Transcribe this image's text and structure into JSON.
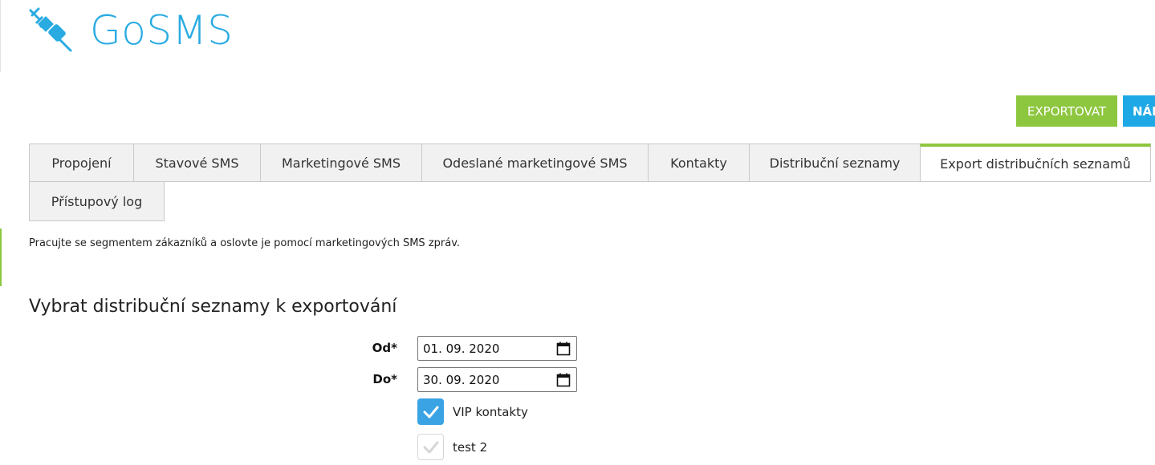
{
  "brand": {
    "name": "GoSMS",
    "color": "#29abe2"
  },
  "actions": {
    "export_label": "EXPORTOVAT",
    "help_label": "NÁP",
    "export_color": "#8dc63f",
    "help_color": "#1ea9e6"
  },
  "tabs": [
    {
      "label": "Propojení",
      "active": false
    },
    {
      "label": "Stavové SMS",
      "active": false
    },
    {
      "label": "Marketingové SMS",
      "active": false
    },
    {
      "label": "Odeslané marketingové SMS",
      "active": false
    },
    {
      "label": "Kontakty",
      "active": false
    },
    {
      "label": "Distribuční seznamy",
      "active": false
    },
    {
      "label": "Export distribučních seznamů",
      "active": true
    },
    {
      "label": "Přístupový log",
      "active": false
    }
  ],
  "intro_text": "Pracujte se segmentem zákazníků a oslovte je pomocí marketingových SMS zpráv.",
  "section_title": "Vybrat distribuční seznamy k exportování",
  "form": {
    "from_label": "Od*",
    "from_value": "01. 09. 2020",
    "to_label": "Do*",
    "to_value": "30. 09. 2020",
    "lists": [
      {
        "label": "VIP kontakty",
        "checked": true
      },
      {
        "label": "test 2",
        "checked": false
      }
    ]
  },
  "icons": {
    "logo": "plug-icon",
    "calendar": "calendar-icon",
    "check": "checkmark-icon"
  }
}
